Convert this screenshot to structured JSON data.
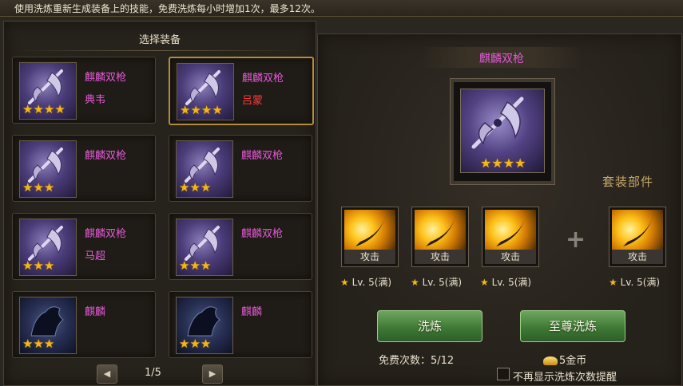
{
  "top_info": "使用洗炼重新生成装备上的技能，免费洗炼每小时增加1次，最多12次。",
  "left_panel": {
    "title": "选择装备",
    "cards": [
      {
        "name": "麒麟双枪",
        "sub": "典韦",
        "sub_color": "purple",
        "stars": "★★★★",
        "selected": false,
        "thumb": "purple-weapon"
      },
      {
        "name": "麒麟双枪",
        "sub": "吕蒙",
        "sub_color": "red",
        "stars": "★★★★",
        "selected": true,
        "thumb": "purple-weapon"
      },
      {
        "name": "麒麟双枪",
        "sub": "",
        "sub_color": "purple",
        "stars": "★★★",
        "selected": false,
        "thumb": "purple-weapon"
      },
      {
        "name": "麒麟双枪",
        "sub": "",
        "sub_color": "purple",
        "stars": "★★★",
        "selected": false,
        "thumb": "purple-weapon"
      },
      {
        "name": "麒麟双枪",
        "sub": "马超",
        "sub_color": "purple",
        "stars": "★★★",
        "selected": false,
        "thumb": "purple-weapon"
      },
      {
        "name": "麒麟双枪",
        "sub": "",
        "sub_color": "purple",
        "stars": "★★★",
        "selected": false,
        "thumb": "purple-weapon"
      },
      {
        "name": "麒麟",
        "sub": "",
        "sub_color": "purple",
        "stars": "★★★",
        "selected": false,
        "thumb": "dark-beast"
      },
      {
        "name": "麒麟",
        "sub": "",
        "sub_color": "purple",
        "stars": "★★★",
        "selected": false,
        "thumb": "dark-beast"
      }
    ],
    "pager": {
      "text": "1/5",
      "prev": "◀",
      "next": "▶"
    }
  },
  "right_panel": {
    "item_name": "麒麟双枪",
    "item_stars": "★★★★",
    "suit_label": "套装部件",
    "skills": [
      {
        "label": "攻击",
        "level": "Lv. 5(满)"
      },
      {
        "label": "攻击",
        "level": "Lv. 5(满)"
      },
      {
        "label": "攻击",
        "level": "Lv. 5(满)"
      },
      {
        "label": "攻击",
        "level": "Lv. 5(满)"
      }
    ],
    "plus": "+",
    "wash_button": "洗炼",
    "supreme_wash_button": "至尊洗炼",
    "free_times_label": "免费次数：5/12",
    "gold_cost": "5金币",
    "no_remind_label": "不再显示洗炼次数提醒"
  },
  "colors": {
    "accent_gold": "#f2b71c",
    "name_purple": "#e45ad8",
    "name_red": "#ff3b3b",
    "button_green": "#4f8a44"
  }
}
